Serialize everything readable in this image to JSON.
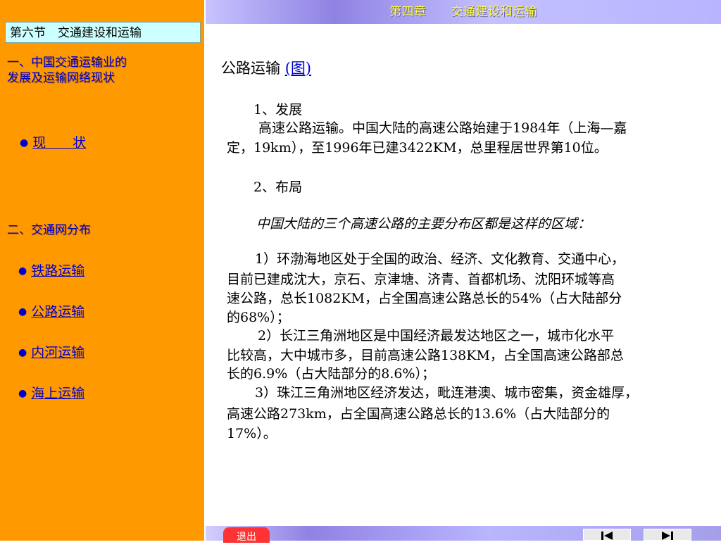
{
  "header": {
    "title": "第四章　　交通建设和运输"
  },
  "sidebar": {
    "section_title": "第六节　交通建设和运输",
    "heading1_line1": "一、中国交通运输业的",
    "heading1_line2": "发展及运输网络现状",
    "link_status": "现　　状",
    "heading2": "二、交通网分布",
    "links": [
      "铁路运输",
      "公路运输",
      "内河运输",
      "海上运输"
    ]
  },
  "content": {
    "title": "公路运输",
    "figure_link": "(图)",
    "dev_heading": "1、发展",
    "dev_text_line1": "高速公路运输。中国大陆的高速公路始建于1984年（上海—嘉",
    "dev_text_line2": "定，19km），至1996年已建3422KM，总里程居世界第10位。",
    "layout_heading": "2、布局",
    "layout_intro": "中国大陆的三个高速公路的主要分布区都是这样的区域：",
    "item1_lines": [
      "1）环渤海地区处于全国的政治、经济、文化教育、交通中心，",
      "目前已建成沈大，京石、京津塘、济青、首都机场、沈阳环城等高",
      "速公路，总长1082KM，占全国高速公路总长的54%（占大陆部分",
      "的68%）；"
    ],
    "item2_lines": [
      "2）长江三角洲地区是中国经济最发达地区之一，城市化水平",
      "比较高，大中城市多，目前高速公路138KM，占全国高速公路部总",
      "长的6.9%（占大陆部分的8.6%）；"
    ],
    "item3_lines": [
      "3）珠江三角洲地区经济发达，毗连港澳、城市密集，资金雄厚，",
      "高速公路273km，占全国高速公路总长的13.6%（占大陆部分的",
      "17%）。"
    ]
  },
  "footer": {
    "exit_label": "退出",
    "prev_icon": "skip-to-first-icon",
    "next_icon": "skip-to-last-icon"
  },
  "colors": {
    "sidebar_bg": "#ff9900",
    "section_box_bg": "#ccffff",
    "link_color": "#0000cc",
    "header_text": "#ffff33",
    "exit_button": "#ff3333"
  }
}
